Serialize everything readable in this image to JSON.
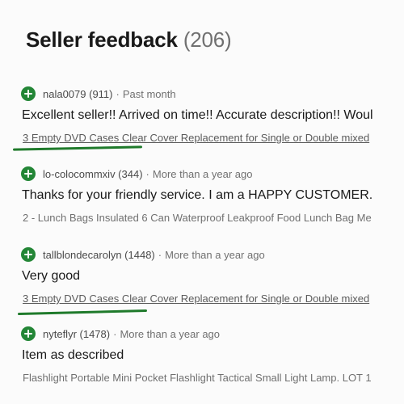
{
  "header": {
    "title": "Seller feedback",
    "count": "(206)"
  },
  "reviews": [
    {
      "user": "nala0079 (911)",
      "separator": "·",
      "time": "Past month",
      "comment": "Excellent seller!! Arrived on time!! Accurate description!! Woul",
      "item": "3 Empty DVD Cases Clear Cover Replacement for Single or Double mixed"
    },
    {
      "user": "lo-colocommxiv (344)",
      "separator": "·",
      "time": "More than a year ago",
      "comment": "Thanks for your friendly service. I am a HAPPY CUSTOMER.",
      "item": "2 - Lunch Bags Insulated 6 Can Waterproof Leakproof Food Lunch Bag Me"
    },
    {
      "user": "tallblondecarolyn (1448)",
      "separator": "·",
      "time": "More than a year ago",
      "comment": "Very good",
      "item": "3 Empty DVD Cases Clear Cover Replacement for Single or Double mixed"
    },
    {
      "user": "nyteflyr (1478)",
      "separator": "·",
      "time": "More than a year ago",
      "comment": "Item as described",
      "item": "Flashlight Portable Mini Pocket Flashlight Tactical Small Light Lamp. LOT 1"
    }
  ],
  "colors": {
    "positive_icon": "#238636",
    "annotation_underline": "#1f7a2b"
  }
}
